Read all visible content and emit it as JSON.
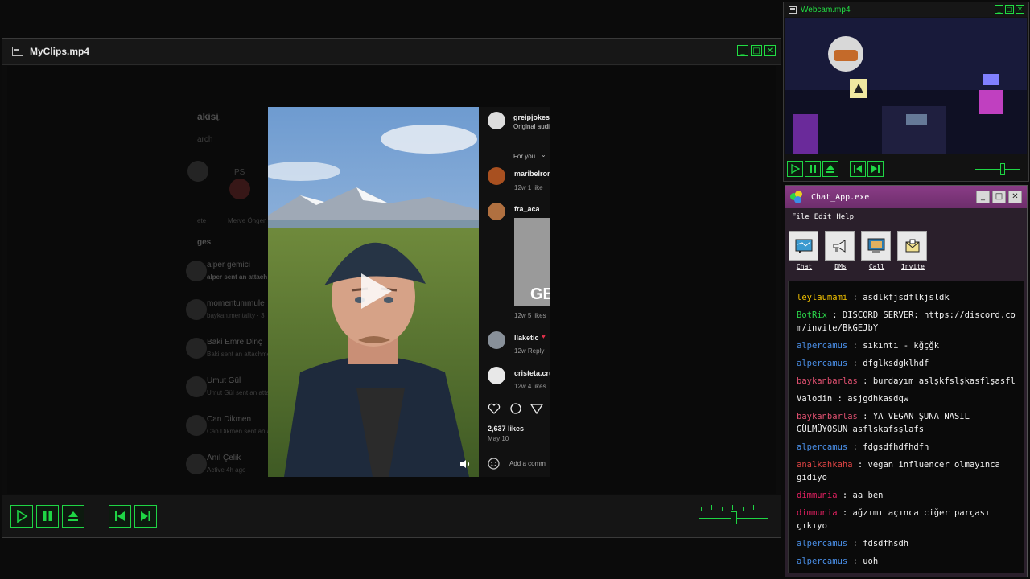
{
  "clips_window": {
    "title": "MyClips.mp4",
    "controls": {
      "minimize": "_",
      "maximize": "□",
      "close": "✕"
    },
    "volume_level": 0.5
  },
  "instagram": {
    "sidebar": {
      "heading_fragment": "akisi",
      "search_fragment": "arch",
      "story_initials": "PS",
      "story_name_a": "ete",
      "story_name_b": "Merve Öngen",
      "section_fragment": "ges",
      "threads": [
        {
          "name": "alper gemici",
          "preview": "alper sent an attach"
        },
        {
          "name": "momentummule",
          "preview": "baykan.mentality · 3"
        },
        {
          "name": "Baki Emre Dinç",
          "preview": "Baki sent an attachme"
        },
        {
          "name": "Umut Gül",
          "preview": "Umut Gül sent an atta"
        },
        {
          "name": "Can Dikmen",
          "preview": "Can Dikmen sent an a"
        },
        {
          "name": "Anıl Çelik",
          "preview": "Active 4h ago"
        }
      ]
    },
    "post": {
      "author": "greipjokes",
      "audio": "Original audi",
      "filter": "For you",
      "comments": [
        {
          "user": "maribelron",
          "meta": "12w   1 like"
        },
        {
          "user": "fra_aca",
          "meta": "12w   5 likes"
        },
        {
          "user": "llaketic",
          "meta": "12w   Reply"
        },
        {
          "user": "cristeta.cru",
          "meta": "12w   4 likes"
        }
      ],
      "gif_text": "GE",
      "likes": "2,637 likes",
      "date": "May 10",
      "add_comment": "Add a comm"
    }
  },
  "webcam_window": {
    "title": "Webcam.mp4",
    "controls": {
      "minimize": "_",
      "maximize": "□",
      "close": "✕"
    },
    "volume_level": 0.6
  },
  "chat_app": {
    "title": "Chat_App.exe",
    "controls": {
      "minimize": "_",
      "maximize": "□",
      "close": "✕"
    },
    "menu": [
      "File",
      "Edit",
      "Help"
    ],
    "tools": [
      {
        "label": "Chat",
        "icon": "chat-icon"
      },
      {
        "label": "DMs",
        "icon": "megaphone-icon"
      },
      {
        "label": "Call",
        "icon": "computer-call-icon"
      },
      {
        "label": "Invite",
        "icon": "envelope-icon"
      }
    ],
    "messages": [
      {
        "user": "leylaumami",
        "color": "#f0c000",
        "text": "asdlkfjsdflkjsldk"
      },
      {
        "user": "BotRix",
        "color": "#2bd44a",
        "text": "DISCORD SERVER: https://discord.com/invite/BkGEJbY"
      },
      {
        "user": "alpercamus",
        "color": "#4a8fe8",
        "text": "sıkıntı - kğçğk"
      },
      {
        "user": "alpercamus",
        "color": "#4a8fe8",
        "text": "dfglksdgklhdf"
      },
      {
        "user": "baykanbarlas",
        "color": "#e05070",
        "text": "burdayım aslşkfslşkasflşasfl"
      },
      {
        "user": "Valodin",
        "color": "#f2f2f2",
        "text": "asjgdhkasdqw"
      },
      {
        "user": "baykanbarlas",
        "color": "#e05070",
        "text": "YA VEGAN ŞUNA NASIL GÜLMÜYOSUN asflşkafsşlafs"
      },
      {
        "user": "alpercamus",
        "color": "#4a8fe8",
        "text": "fdgsdfhdfhdfh"
      },
      {
        "user": "analkahkaha",
        "color": "#e04444",
        "text": "vegan influencer olmayınca gidiyo"
      },
      {
        "user": "dimmunia",
        "color": "#e02060",
        "text": "aa ben"
      },
      {
        "user": "dimmunia",
        "color": "#e02060",
        "text": "ağzımı açınca ciğer parçası çıkıyo"
      },
      {
        "user": "alpercamus",
        "color": "#4a8fe8",
        "text": "fdsdfhsdh"
      },
      {
        "user": "alpercamus",
        "color": "#4a8fe8",
        "text": "uoh"
      }
    ]
  },
  "colors": {
    "accent_green": "#1fd545",
    "chat_titlebar": "#7a3478"
  }
}
